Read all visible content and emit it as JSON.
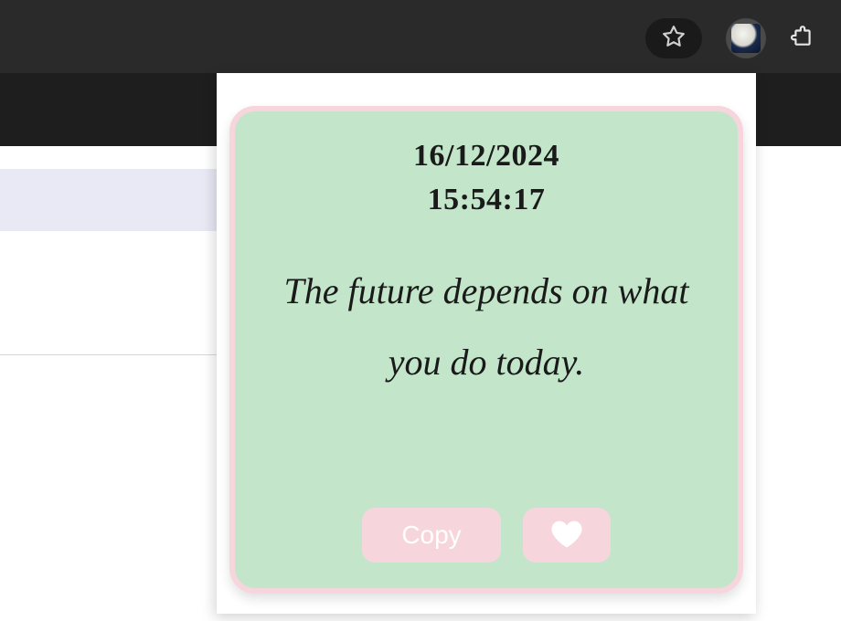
{
  "browser": {
    "avatar_label": "profile-avatar"
  },
  "popup": {
    "date": "16/12/2024",
    "time": "15:54:17",
    "quote": "The future depends on what you do today.",
    "buttons": {
      "copy": "Copy"
    },
    "colors": {
      "card_bg": "#c3e5c9",
      "card_border": "#f7d5dc",
      "button_bg": "#f7d5dc"
    }
  }
}
